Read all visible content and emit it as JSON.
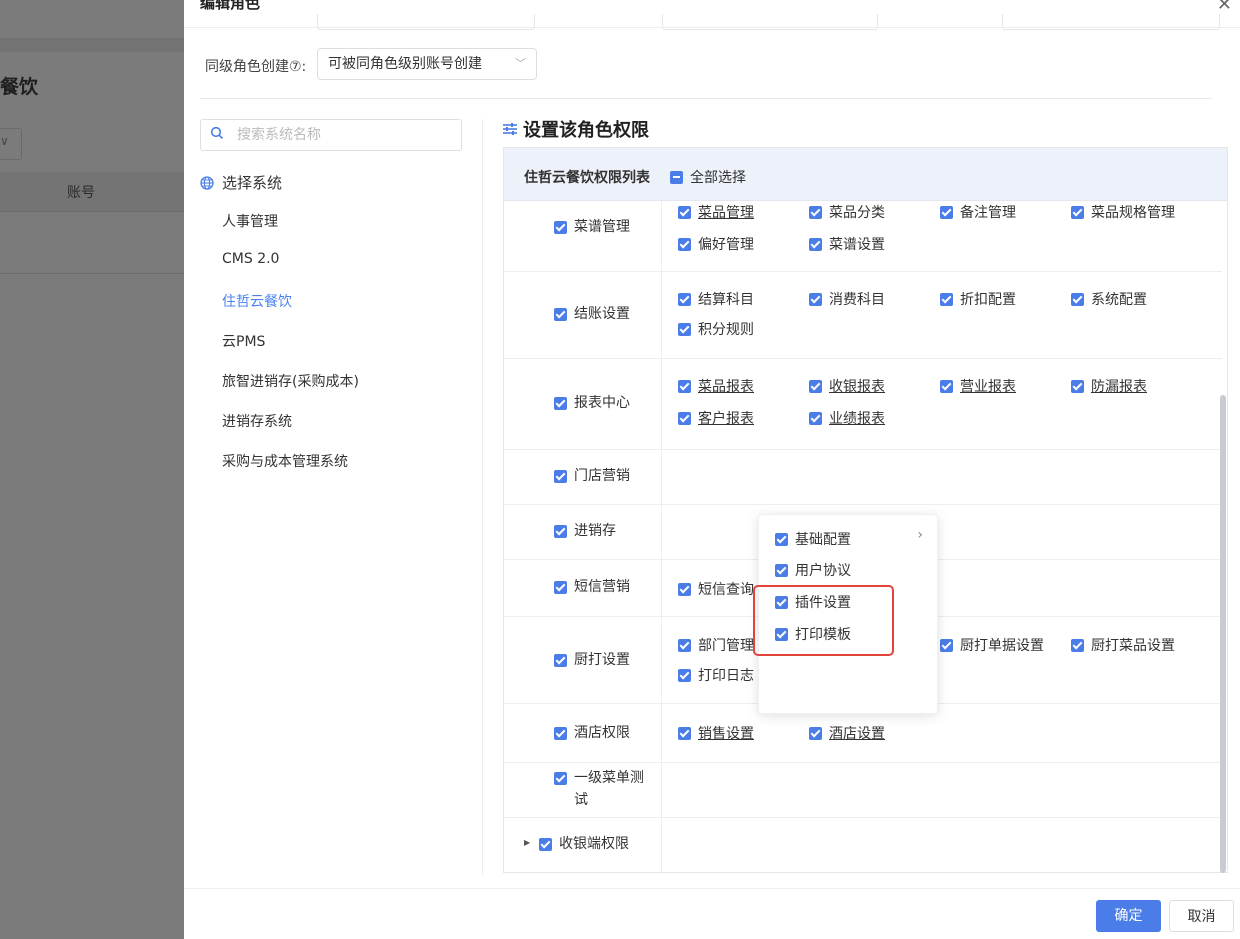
{
  "background": {
    "title": "餐饮",
    "column_header": "账号"
  },
  "dialog": {
    "title": "编辑角色",
    "close_icon": "close-icon",
    "peer_role_label": "同级角色创建⑦:",
    "peer_role_value": "可被同角色级别账号创建"
  },
  "systems": {
    "search_placeholder": "搜索系统名称",
    "header": "选择系统",
    "items": [
      {
        "label": "人事管理"
      },
      {
        "label": "CMS 2.0"
      },
      {
        "label": "住哲云餐饮"
      },
      {
        "label": "云PMS"
      },
      {
        "label": "旅智进销存(采购成本)"
      },
      {
        "label": "进销存系统"
      },
      {
        "label": "采购与成本管理系统"
      }
    ],
    "active": "住哲云餐饮"
  },
  "permissions": {
    "title": "设置该角色权限",
    "table_name": "住哲云餐饮权限列表",
    "select_all": "全部选择",
    "rows": [
      {
        "category": "菜谱管理",
        "perms": [
          "菜品管理",
          "菜品分类",
          "备注管理",
          "菜品规格管理",
          "偏好管理",
          "菜谱设置"
        ]
      },
      {
        "category": "结账设置",
        "perms": [
          "结算科目",
          "消费科目",
          "折扣配置",
          "系统配置",
          "积分规则"
        ]
      },
      {
        "category": "报表中心",
        "perms": [
          "菜品报表",
          "收银报表",
          "营业报表",
          "防漏报表",
          "客户报表",
          "业绩报表"
        ]
      },
      {
        "category": "门店营销",
        "perms": []
      },
      {
        "category": "进销存",
        "perms": []
      },
      {
        "category": "短信营销",
        "perms": [
          "短信查询"
        ]
      },
      {
        "category": "厨打设置",
        "perms": [
          "部门管理",
          "厨打单据设置",
          "厨打菜品设置",
          "打印日志"
        ]
      },
      {
        "category": "酒店权限",
        "perms": [
          "销售设置",
          "酒店设置"
        ]
      },
      {
        "category": "一级菜单测试",
        "perms": []
      },
      {
        "category": "收银端权限",
        "perms": []
      }
    ]
  },
  "popup": {
    "items": [
      {
        "label": "基础配置",
        "has_children": true
      },
      {
        "label": "用户协议"
      },
      {
        "label": "插件设置"
      },
      {
        "label": "打印模板"
      }
    ]
  },
  "footer": {
    "ok": "确定",
    "cancel": "取消"
  },
  "colors": {
    "accent": "#4a7de8",
    "highlight_box": "#e0443a",
    "active_link": "#4a82f0"
  }
}
